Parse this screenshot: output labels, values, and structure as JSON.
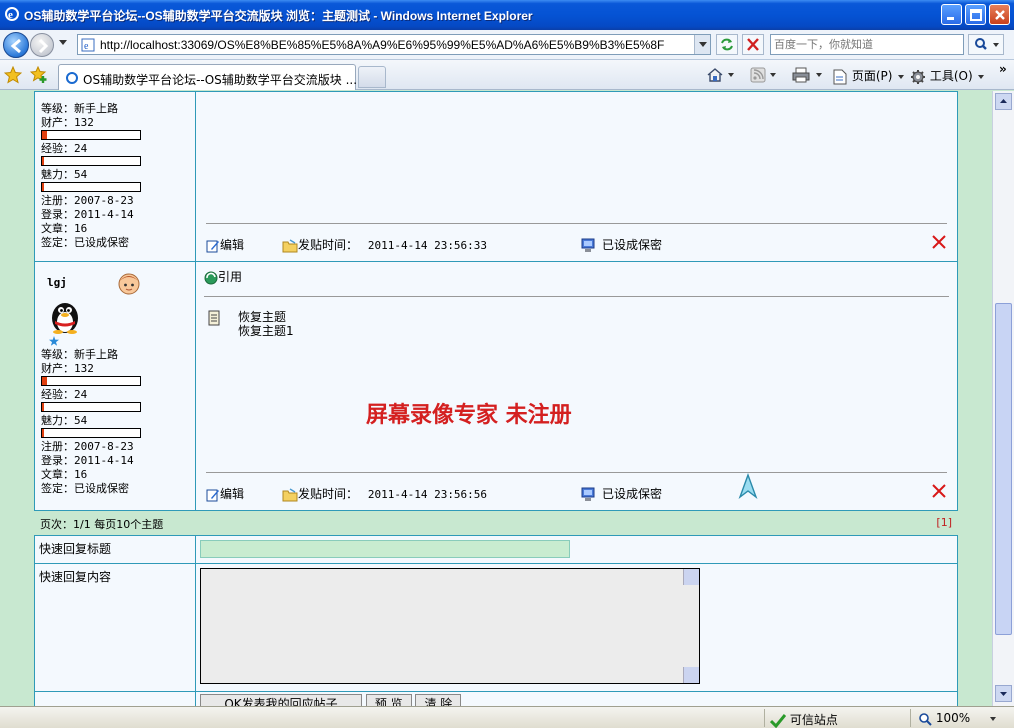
{
  "window": {
    "title": "OS辅助数学平台论坛--OS辅助数学平台交流版块 浏览：主题测试 - Windows Internet Explorer"
  },
  "address": {
    "url": "http://localhost:33069/OS%E8%BE%85%E5%8A%A9%E6%95%99%E5%AD%A6%E5%B9%B3%E5%8F",
    "search_placeholder": "百度一下，你就知道"
  },
  "tab": {
    "label": "OS辅助数学平台论坛--OS辅助数学平台交流版块 ..."
  },
  "commands": {
    "page": "页面(P)",
    "tools": "工具(O)",
    "more": "»"
  },
  "posts": [
    {
      "author": "",
      "level": "等级：新手上路",
      "wealth": "财产：132",
      "wealth_level": 0.05,
      "exp": "经验：24",
      "exp_level": 0.02,
      "charm": "魅力：54",
      "charm_level": 0.02,
      "register": "注册：2007-8-23",
      "login": "登录：2011-4-14",
      "articles": "文章：16",
      "signature": "签定：已设成保密",
      "edit": "编辑",
      "time_label": "发贴时间：",
      "time": "2011-4-14 23:56:33",
      "sign_label": "已设成保密"
    },
    {
      "author": "lgj",
      "level": "等级：新手上路",
      "wealth": "财产：132",
      "wealth_level": 0.05,
      "exp": "经验：24",
      "exp_level": 0.02,
      "charm": "魅力：54",
      "charm_level": 0.02,
      "register": "注册：2007-8-23",
      "login": "登录：2011-4-14",
      "articles": "文章：16",
      "signature": "签定：已设成保密",
      "quote": "引用",
      "reply_title": "恢复主题",
      "reply_body": "恢复主题1",
      "edit": "编辑",
      "time_label": "发贴时间：",
      "time": "2011-4-14 23:56:56",
      "sign_label": "已设成保密"
    }
  ],
  "watermark": "屏幕录像专家  未注册",
  "pager": {
    "text": "页次：1/1 每页10个主题",
    "page_link": "[1]"
  },
  "quick_reply": {
    "title_label": "快速回复标题",
    "content_label": "快速回复内容",
    "submit": "OK发表我的回应帖子",
    "preview": "预 览",
    "clear": "清 除"
  },
  "status": {
    "zone": "可信站点",
    "zoom": "100%"
  }
}
